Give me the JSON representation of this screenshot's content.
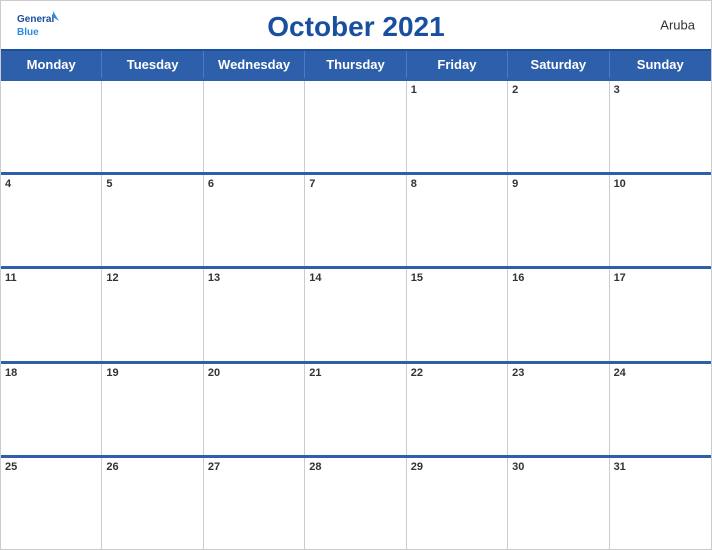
{
  "header": {
    "title": "October 2021",
    "country": "Aruba",
    "logo_general": "General",
    "logo_blue": "Blue"
  },
  "dayHeaders": [
    "Monday",
    "Tuesday",
    "Wednesday",
    "Thursday",
    "Friday",
    "Saturday",
    "Sunday"
  ],
  "weeks": [
    [
      {
        "day": "",
        "empty": true
      },
      {
        "day": "",
        "empty": true
      },
      {
        "day": "",
        "empty": true
      },
      {
        "day": "",
        "empty": true
      },
      {
        "day": "1"
      },
      {
        "day": "2"
      },
      {
        "day": "3"
      }
    ],
    [
      {
        "day": "4"
      },
      {
        "day": "5"
      },
      {
        "day": "6"
      },
      {
        "day": "7"
      },
      {
        "day": "8"
      },
      {
        "day": "9"
      },
      {
        "day": "10"
      }
    ],
    [
      {
        "day": "11"
      },
      {
        "day": "12"
      },
      {
        "day": "13"
      },
      {
        "day": "14"
      },
      {
        "day": "15"
      },
      {
        "day": "16"
      },
      {
        "day": "17"
      }
    ],
    [
      {
        "day": "18"
      },
      {
        "day": "19"
      },
      {
        "day": "20"
      },
      {
        "day": "21"
      },
      {
        "day": "22"
      },
      {
        "day": "23"
      },
      {
        "day": "24"
      }
    ],
    [
      {
        "day": "25"
      },
      {
        "day": "26"
      },
      {
        "day": "27"
      },
      {
        "day": "28"
      },
      {
        "day": "29"
      },
      {
        "day": "30"
      },
      {
        "day": "31"
      }
    ]
  ],
  "colors": {
    "header_blue": "#2d5faa",
    "title_blue": "#1a4fa0",
    "border_blue": "#2d5faa"
  }
}
